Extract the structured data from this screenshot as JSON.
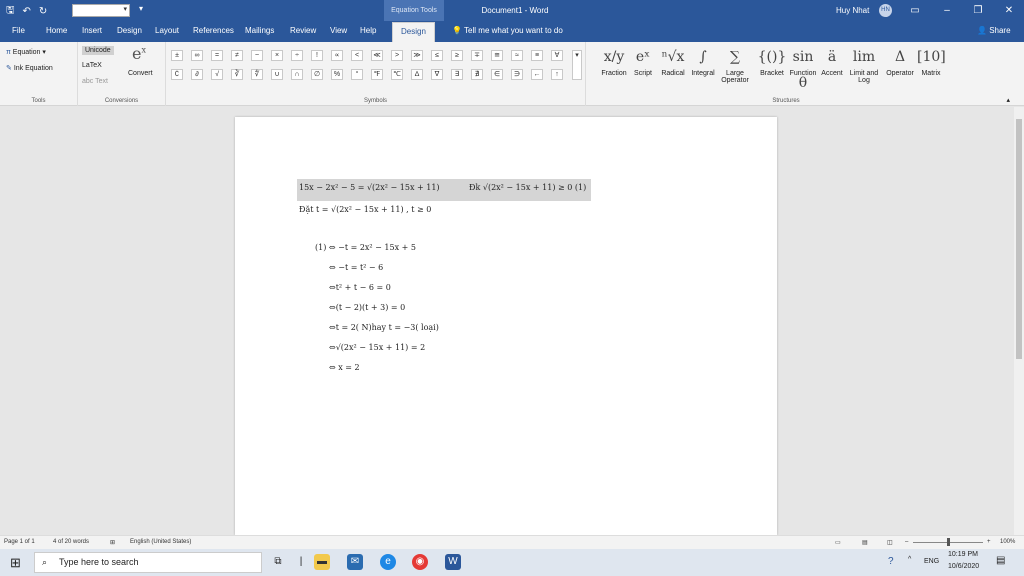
{
  "title_bar": {
    "context_header": "Equation Tools",
    "document_title": "Document1  -  Word",
    "user_name": "Huy Nhat",
    "user_initials": "HN"
  },
  "tabs": [
    "File",
    "Home",
    "Insert",
    "Design",
    "Layout",
    "References",
    "Mailings",
    "Review",
    "View",
    "Help",
    "Design"
  ],
  "tell_me": "Tell me what you want to do",
  "share": "Share",
  "ribbon": {
    "tools": {
      "equation": "Equation",
      "ink": "Ink Equation",
      "label": "Tools"
    },
    "conversions": {
      "unicode": "Unicode",
      "latex": "LaTeX",
      "text": "abc Text",
      "convert": "Convert",
      "label": "Conversions"
    },
    "symbols_label": "Symbols",
    "symbols": [
      "±",
      "∞",
      "=",
      "≠",
      "~",
      "×",
      "÷",
      "!",
      "∝",
      "<",
      "≪",
      ">",
      "≫",
      "≤",
      "≥",
      "∓",
      "≅",
      "≈",
      "≡",
      "∀",
      "∁",
      "∂",
      "√",
      "∛",
      "∜",
      "∪",
      "∩",
      "∅",
      "%",
      "°",
      "℉",
      "℃",
      "∆",
      "∇",
      "∃",
      "∄",
      "∈",
      "∋",
      "←",
      "↑"
    ],
    "structures_label": "Structures",
    "structures": [
      {
        "icon": "x/y",
        "label": "Fraction"
      },
      {
        "icon": "eˣ",
        "label": "Script"
      },
      {
        "icon": "ⁿ√x",
        "label": "Radical"
      },
      {
        "icon": "∫",
        "label": "Integral"
      },
      {
        "icon": "∑",
        "label": "Large Operator"
      },
      {
        "icon": "{()}",
        "label": "Bracket"
      },
      {
        "icon": "sin θ",
        "label": "Function"
      },
      {
        "icon": "ä",
        "label": "Accent"
      },
      {
        "icon": "lim",
        "label": "Limit and Log"
      },
      {
        "icon": "Δ",
        "label": "Operator"
      },
      {
        "icon": "[10]",
        "label": "Matrix"
      }
    ]
  },
  "document": {
    "line1": "15x − 2x² − 5 = √(2x² − 15x + 11)",
    "line1_cond": "Đk √(2x² − 15x + 11) ≥ 0 (1)",
    "line2": "Đặt t = √(2x² − 15x + 11) , t ≥ 0",
    "steps": [
      "(1) ⇔ −t = 2x² − 15x + 5",
      "⇔ −t = t² − 6",
      "⇔t² + t − 6 = 0",
      "⇔(t − 2)(t + 3) = 0",
      "⇔t = 2( N)hay t = −3( loại)",
      "⇔√(2x² − 15x + 11) = 2",
      "⇔ x = 2"
    ]
  },
  "status": {
    "page": "Page 1 of 1",
    "words": "4 of 20 words",
    "language": "English (United States)",
    "zoom": "100%"
  },
  "taskbar": {
    "search": "Type here to search",
    "lang": "ENG",
    "time": "10:19 PM",
    "date": "10/6/2020"
  }
}
